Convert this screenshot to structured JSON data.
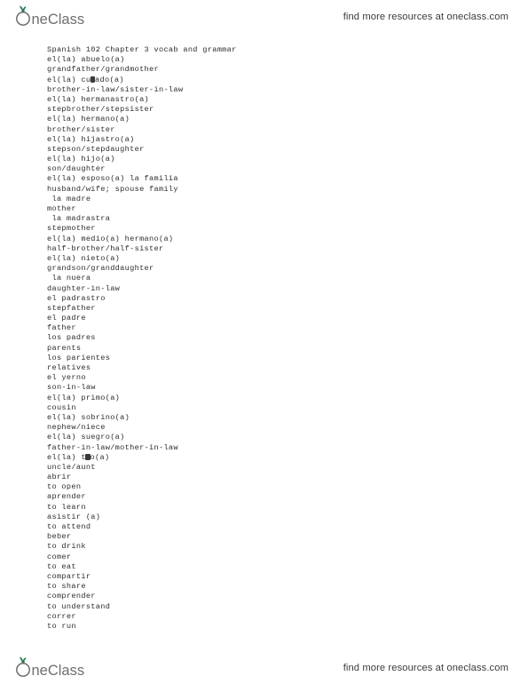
{
  "header": {
    "logo_text": "OneClass",
    "logo_icon": "sprout-leaf-icon",
    "promo_text": "find more resources at oneclass.com"
  },
  "footer": {
    "logo_text": "OneClass",
    "logo_icon": "sprout-leaf-icon",
    "promo_text": "find more resources at oneclass.com"
  },
  "colors": {
    "leaf_green": "#1f7a4d",
    "logo_gray": "#6e6e6e",
    "body_text": "#2d2d2d",
    "promo_text": "#3b3b3b",
    "page_background": "#ffffff"
  },
  "document": {
    "title": "Spanish 102 Chapter 3 vocab and grammar",
    "lines": [
      "Spanish 102 Chapter 3 vocab and grammar",
      "el(la) abuelo(a)",
      "grandfather/grandmother",
      "el(la) cuñado(a)",
      "brother-in-law/sister-in-law",
      "el(la) hermanastro(a)",
      "stepbrother/stepsister",
      "el(la) hermano(a)",
      "brother/sister",
      "el(la) hijastro(a)",
      "stepson/stepdaughter",
      "el(la) hijo(a)",
      "son/daughter",
      "el(la) esposo(a) la familia",
      "husband/wife; spouse family",
      " la madre",
      "mother",
      " la madrastra",
      "stepmother",
      "el(la) medio(a) hermano(a)",
      "half-brother/half-sister",
      "el(la) nieto(a)",
      "grandson/granddaughter",
      " la nuera",
      "daughter-in-law",
      "el padrastro",
      "stepfather",
      "el padre",
      "father",
      "los padres",
      "parents",
      "los parientes",
      "relatives",
      "el yerno",
      "son-in-law",
      "el(la) primo(a)",
      "cousin",
      "el(la) sobrino(a)",
      "nephew/niece",
      "el(la) suegro(a)",
      "father-in-law/mother-in-law",
      "el(la) tío(a)",
      "uncle/aunt",
      "abrir",
      "to open",
      "aprender",
      "to learn",
      "asistir (a)",
      "to attend",
      "beber",
      "to drink",
      "comer",
      "to eat",
      "compartir",
      "to share",
      "comprender",
      "to understand",
      "correr",
      "to run"
    ],
    "broken_glyph_lines": [
      {
        "index": 3,
        "before": "el(la) cu",
        "after": "ado(a)"
      },
      {
        "index": 41,
        "before": "el(la) t",
        "after": "o(a)"
      }
    ]
  }
}
